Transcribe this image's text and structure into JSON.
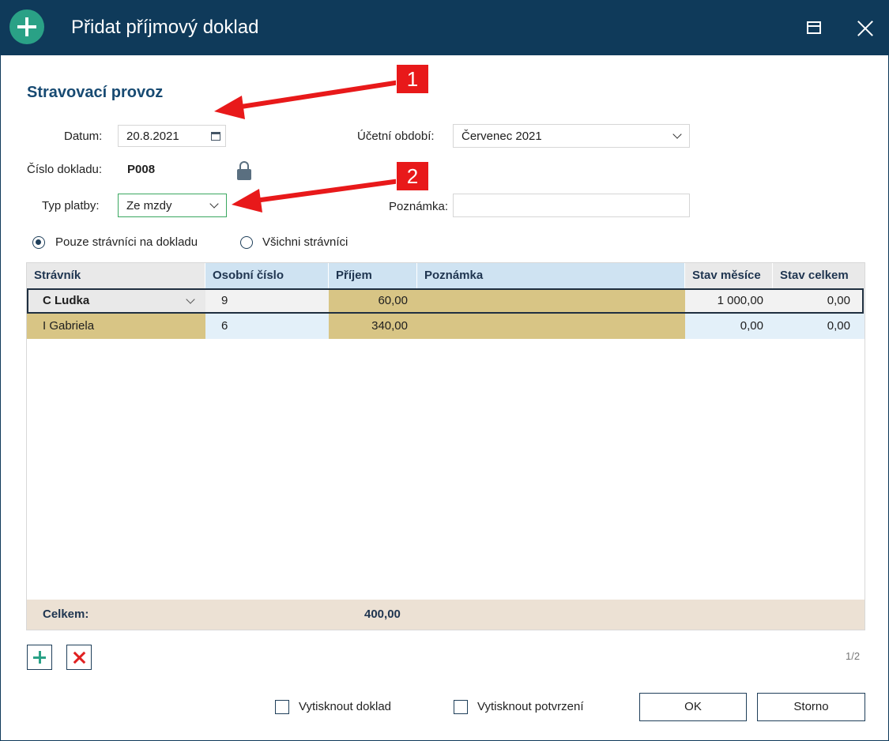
{
  "window": {
    "title": "Přidat příjmový doklad"
  },
  "section_title": "Stravovací provoz",
  "form": {
    "datum_label": "Datum:",
    "datum_value": "20.8.2021",
    "obdobi_label": "Účetní období:",
    "obdobi_value": "Červenec 2021",
    "cislo_label": "Číslo dokladu:",
    "cislo_value": "P008",
    "typ_label": "Typ platby:",
    "typ_value": "Ze mzdy",
    "poznamka_label": "Poznámka:",
    "poznamka_value": ""
  },
  "filter": {
    "option_1": "Pouze strávníci na dokladu",
    "option_2": "Všichni strávníci",
    "selected": 1
  },
  "table": {
    "columns": [
      "Strávník",
      "Osobní číslo",
      "Příjem",
      "Poznámka",
      "Stav měsíce",
      "Stav celkem"
    ],
    "rows": [
      {
        "stravnik": "C Ludka",
        "cislo": "9",
        "prijem": "60,00",
        "poznamka": "",
        "stav_mesice": "1 000,00",
        "stav_celkem": "0,00",
        "selected": true
      },
      {
        "stravnik": "I Gabriela",
        "cislo": "6",
        "prijem": "340,00",
        "poznamka": "",
        "stav_mesice": "0,00",
        "stav_celkem": "0,00",
        "selected": false
      }
    ],
    "footer_label": "Celkem:",
    "footer_total": "400,00"
  },
  "pager": "1/2",
  "print_doc_label": "Vytisknout doklad",
  "print_conf_label": "Vytisknout potvrzení",
  "ok_label": "OK",
  "cancel_label": "Storno",
  "annotations": [
    "1",
    "2"
  ],
  "colors": {
    "titlebar": "#0f3a5a",
    "accent_green": "#2aa186",
    "highlight": "#d8c585",
    "header_blue": "#cfe3f2",
    "annotation_red": "#e8191a"
  }
}
